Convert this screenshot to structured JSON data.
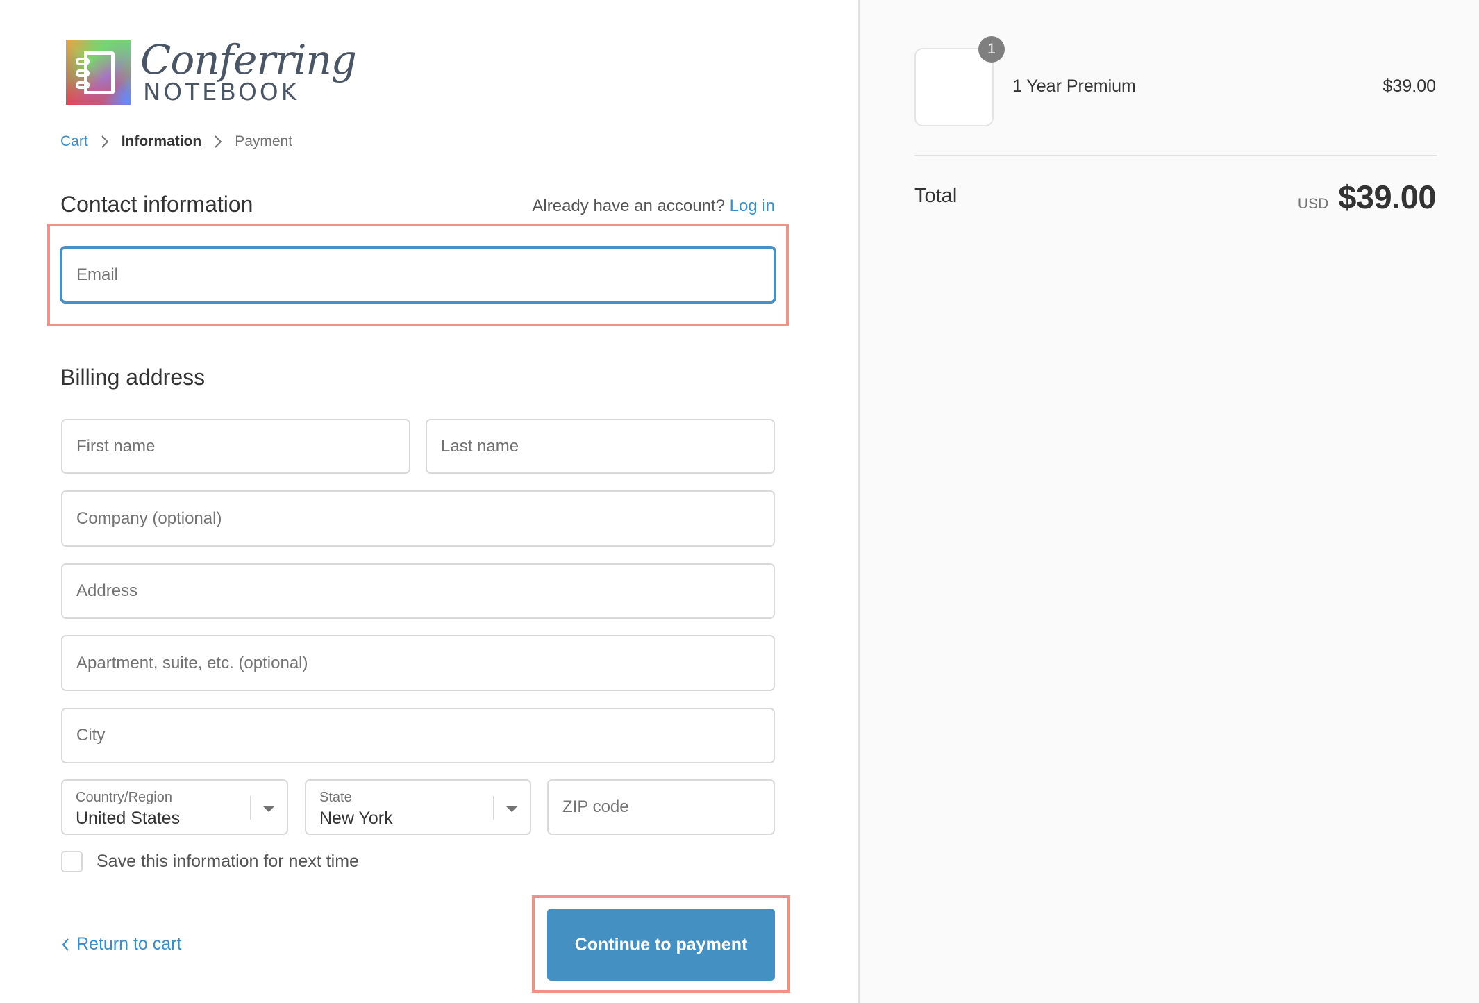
{
  "brand": {
    "logo_script": "Conferring",
    "logo_caps": "NOTEBOOK"
  },
  "breadcrumb": {
    "items": [
      {
        "label": "Cart",
        "state": "link"
      },
      {
        "label": "Information",
        "state": "current"
      },
      {
        "label": "Payment",
        "state": "upcoming"
      }
    ],
    "separator_icon": "chevron-right-icon"
  },
  "contact": {
    "heading": "Contact information",
    "account_prompt": "Already have an account?",
    "login_label": "Log in",
    "email": {
      "placeholder": "Email",
      "value": ""
    }
  },
  "billing": {
    "heading": "Billing address",
    "first_name": {
      "placeholder": "First name",
      "value": ""
    },
    "last_name": {
      "placeholder": "Last name",
      "value": ""
    },
    "company": {
      "placeholder": "Company (optional)",
      "value": ""
    },
    "address": {
      "placeholder": "Address",
      "value": ""
    },
    "apartment": {
      "placeholder": "Apartment, suite, etc. (optional)",
      "value": ""
    },
    "city": {
      "placeholder": "City",
      "value": ""
    },
    "country": {
      "label": "Country/Region",
      "value": "United States"
    },
    "state": {
      "label": "State",
      "value": "New York"
    },
    "zip": {
      "placeholder": "ZIP code",
      "value": ""
    }
  },
  "save_info": {
    "label": "Save this information for next time",
    "checked": false
  },
  "actions": {
    "return_label": "Return to cart",
    "continue_label": "Continue to payment"
  },
  "order_summary": {
    "items": [
      {
        "name": "1 Year Premium",
        "quantity": "1",
        "price": "$39.00"
      }
    ],
    "total_label": "Total",
    "currency": "USD",
    "total": "$39.00"
  },
  "colors": {
    "accent": "#3b8dc6",
    "button": "#4490c3",
    "highlight": "#ef9387",
    "sidebar_bg": "#fafafa"
  }
}
